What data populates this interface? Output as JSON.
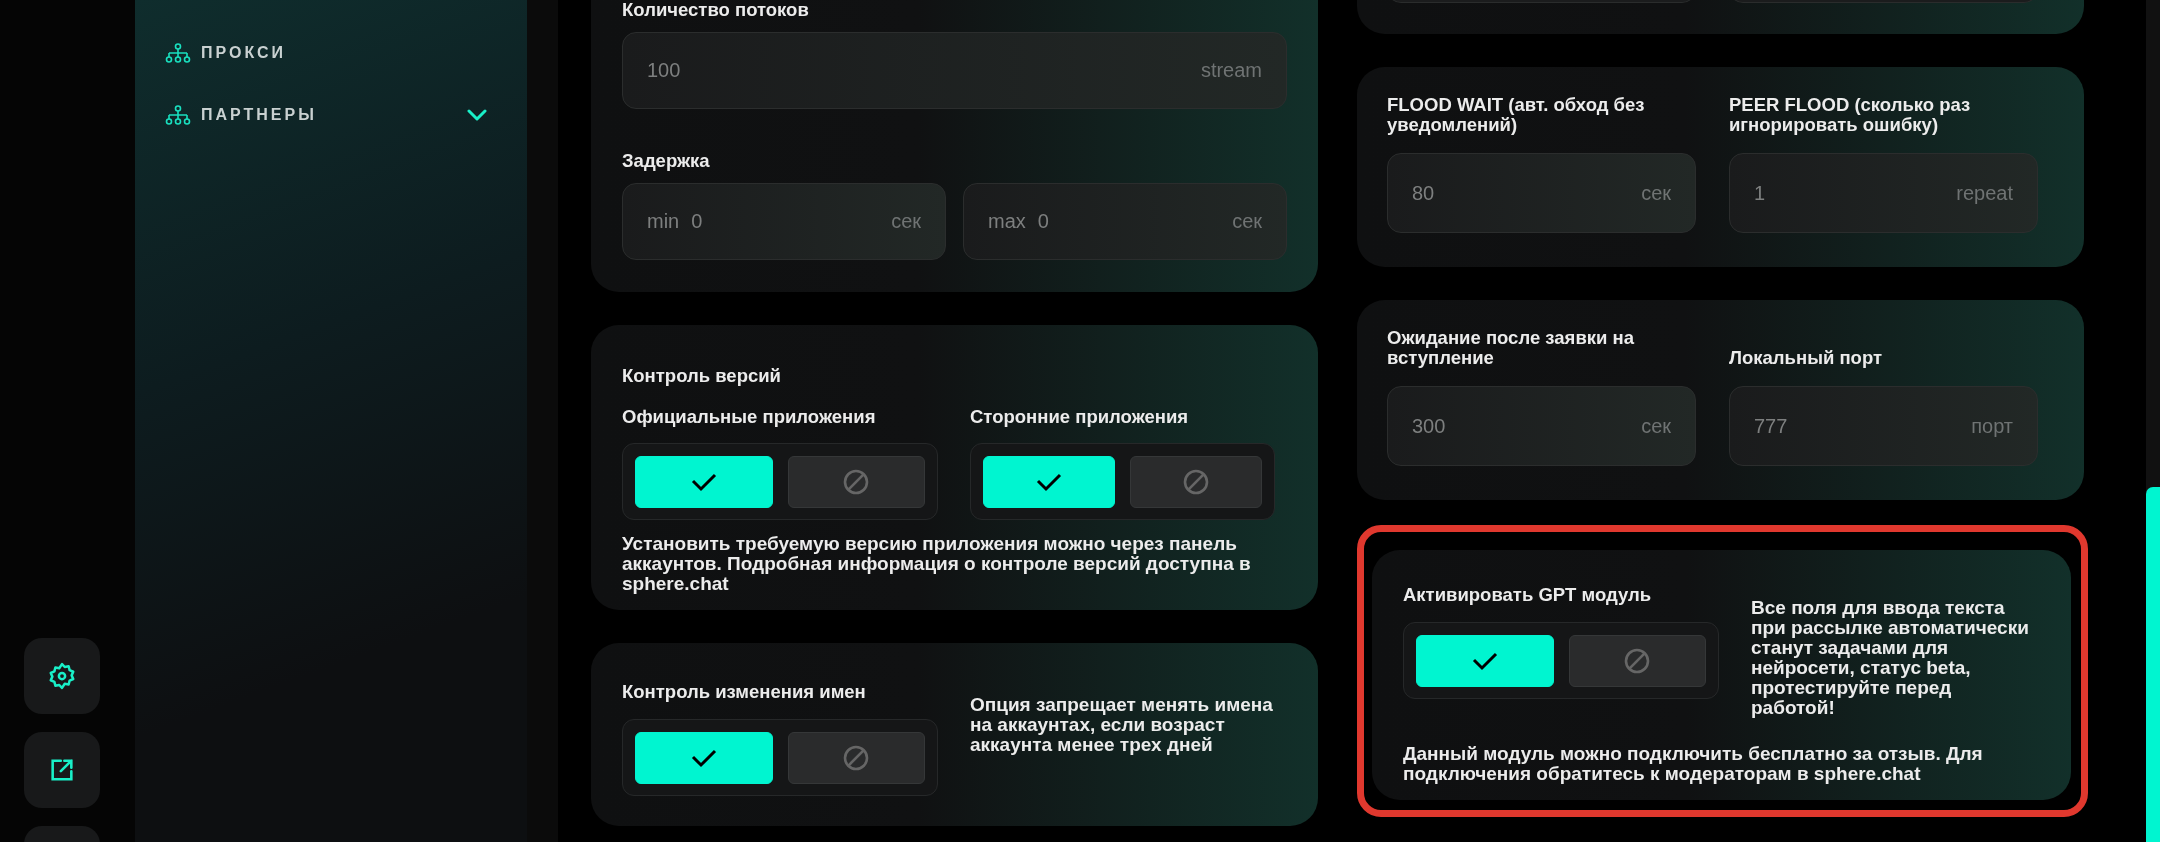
{
  "rail": [
    {
      "kind": "settings"
    },
    {
      "kind": "external"
    },
    {
      "kind": "blank"
    }
  ],
  "sidebar": {
    "items": [
      {
        "label": "ПРОКСИ"
      },
      {
        "label": "ПАРТНЕРЫ",
        "expanded": false
      }
    ]
  },
  "left_cards": [
    {
      "kind": "stack",
      "sections": [
        {
          "label": "Количество потоков",
          "fields": [
            {
              "value": "100",
              "unit": "stream"
            }
          ]
        },
        {
          "label": "Задержка",
          "fields": [
            {
              "prefix": "min",
              "value": "0",
              "unit": "сек"
            },
            {
              "prefix": "max",
              "value": "0",
              "unit": "сек"
            }
          ]
        }
      ]
    },
    {
      "kind": "version",
      "title": "Контроль версий",
      "toggles": [
        {
          "label": "Официальные приложения",
          "on": true
        },
        {
          "label": "Сторонние приложения",
          "on": true
        }
      ],
      "note": "Установить требуемую версию приложения можно через панель аккаунтов. Подробная информация о контроле версий доступна в sphere.chat"
    },
    {
      "kind": "toggle_note",
      "title": "Контроль изменения имен",
      "on": true,
      "note": "Опция запрещает менять имена на аккаунтах, если возраст аккаунта менее трех дней",
      "highlighted": false
    }
  ],
  "right_cards": [
    {
      "kind": "stub"
    },
    {
      "kind": "pairs",
      "items": [
        {
          "label": "FLOOD WAIT (авт. обход без уведомлений)",
          "value": "80",
          "unit": "сек"
        },
        {
          "label": "PEER FLOOD (сколько раз игнорировать ошибку)",
          "value": "1",
          "unit": "repeat"
        }
      ]
    },
    {
      "kind": "pairs",
      "items": [
        {
          "label": "Ожидание после заявки на вступление",
          "value": "300",
          "unit": "сек"
        },
        {
          "label": "Локальный порт",
          "value": "777",
          "unit": "порт"
        }
      ]
    },
    {
      "kind": "toggle_note",
      "title": "Активировать GPT модуль",
      "on": true,
      "note": "Все поля для ввода текста при рассылке автоматически станут задачами для нейросети, статус beta, протестируйте перед работой!",
      "footnote": "Данный модуль можно подключить бесплатно за отзыв. Для подключения обратитесь к модераторам в sphere.chat",
      "highlighted": true
    }
  ]
}
